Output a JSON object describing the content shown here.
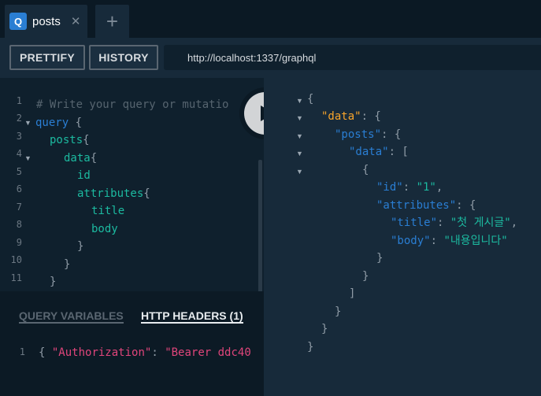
{
  "tabs": [
    {
      "badge": "Q",
      "title": "posts",
      "close": "✕"
    }
  ],
  "add_tab": "+",
  "toolbar": {
    "prettify": "PRETTIFY",
    "history": "HISTORY",
    "url": "http://localhost:1337/graphql"
  },
  "query_lines": [
    {
      "n": "1",
      "text": "# Write your query or mutation here"
    },
    {
      "n": "2",
      "text": "query {"
    },
    {
      "n": "3",
      "text": "  posts{"
    },
    {
      "n": "4",
      "text": "    data{"
    },
    {
      "n": "5",
      "text": "      id"
    },
    {
      "n": "6",
      "text": "      attributes{"
    },
    {
      "n": "7",
      "text": "        title"
    },
    {
      "n": "8",
      "text": "        body"
    },
    {
      "n": "9",
      "text": "      }"
    },
    {
      "n": "10",
      "text": "    }"
    },
    {
      "n": "11",
      "text": "  }"
    }
  ],
  "query_tokens": {
    "comment": "# Write your query or mutatio",
    "query_kw": "query",
    "posts": "posts",
    "data": "data",
    "id": "id",
    "attributes": "attributes",
    "title": "title",
    "body": "body"
  },
  "bottom_tabs": {
    "variables": "QUERY VARIABLES",
    "headers": "HTTP HEADERS (1)"
  },
  "headers_line": {
    "n": "1",
    "open": "{",
    "key": "\"Authorization\"",
    "colon": ":",
    "value": "\"Bearer ddc40"
  },
  "result": {
    "k_data": "\"data\"",
    "k_posts": "\"posts\"",
    "k_data2": "\"data\"",
    "k_id": "\"id\"",
    "v_id": "\"1\"",
    "k_attributes": "\"attributes\"",
    "k_title": "\"title\"",
    "v_title": "\"첫 게시글\"",
    "k_body": "\"body\"",
    "v_body": "\"내용입니다\""
  },
  "colors": {
    "background": "#0f202d",
    "result_background": "#172a3a",
    "keyword": "#2a7ed3",
    "field": "#1cbaa0",
    "string": "#e0457b",
    "result_root_key": "#f9a52b"
  },
  "icons": {
    "tab": "graphql-query-icon",
    "close": "close-icon",
    "add": "plus-icon",
    "run": "play-icon"
  }
}
